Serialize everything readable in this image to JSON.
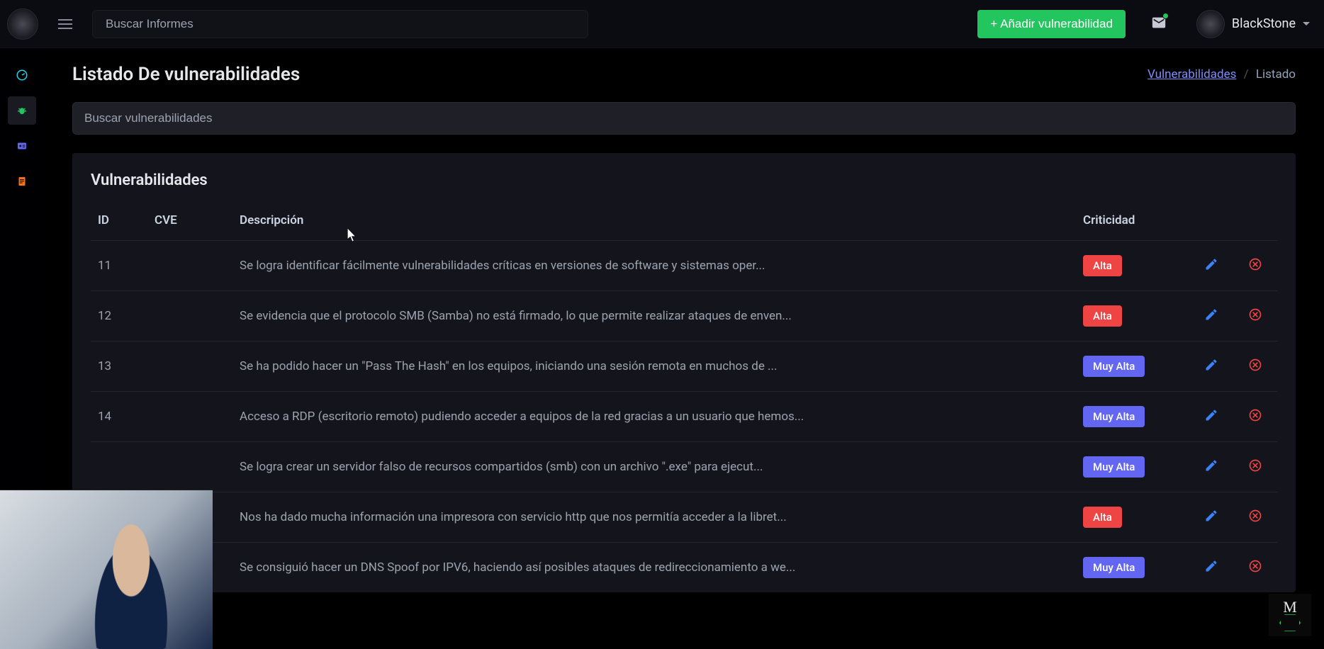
{
  "app": {
    "search_placeholder": "Buscar Informes",
    "add_button": "+ Añadir vulnerabilidad",
    "user_name": "BlackStone"
  },
  "sidebar": {
    "items": [
      {
        "name": "dashboard",
        "color": "#22d3ee"
      },
      {
        "name": "bugs",
        "color": "#22c55e"
      },
      {
        "name": "reports",
        "color": "#6366f1"
      },
      {
        "name": "documents",
        "color": "#f97316"
      }
    ]
  },
  "page": {
    "title": "Listado De vulnerabilidades",
    "breadcrumb_link": "Vulnerabilidades",
    "breadcrumb_current": "Listado",
    "filter_placeholder": "Buscar vulnerabilidades",
    "card_title": "Vulnerabilidades"
  },
  "table": {
    "headers": {
      "id": "ID",
      "cve": "CVE",
      "desc": "Descripción",
      "crit": "Criticidad"
    },
    "rows": [
      {
        "id": "11",
        "cve": "",
        "desc": "Se logra identificar fácilmente vulnerabilidades críticas en versiones de software y sistemas oper...",
        "crit": "Alta"
      },
      {
        "id": "12",
        "cve": "",
        "desc": "Se evidencia que el protocolo SMB (Samba) no está firmado, lo que permite realizar ataques de enven...",
        "crit": "Alta"
      },
      {
        "id": "13",
        "cve": "",
        "desc": "Se ha podido hacer un \"Pass The Hash\" en los equipos, iniciando una sesión remota en muchos de ...",
        "crit": "Muy Alta"
      },
      {
        "id": "14",
        "cve": "",
        "desc": "Acceso a RDP (escritorio remoto) pudiendo acceder a equipos de la red gracias a un usuario que hemos...",
        "crit": "Muy Alta"
      },
      {
        "id": "",
        "cve": "",
        "desc": "Se logra crear un servidor falso de recursos compartidos (smb) con un archivo \".exe\" para ejecut...",
        "crit": "Muy Alta"
      },
      {
        "id": "",
        "cve": "",
        "desc": "Nos ha dado mucha información una impresora con servicio http que nos permitía acceder a la libret...",
        "crit": "Alta"
      },
      {
        "id": "",
        "cve": "",
        "desc": "Se consiguió hacer un DNS Spoof por IPV6, haciendo así posibles ataques de redireccionamiento a we...",
        "crit": "Muy Alta"
      }
    ]
  }
}
